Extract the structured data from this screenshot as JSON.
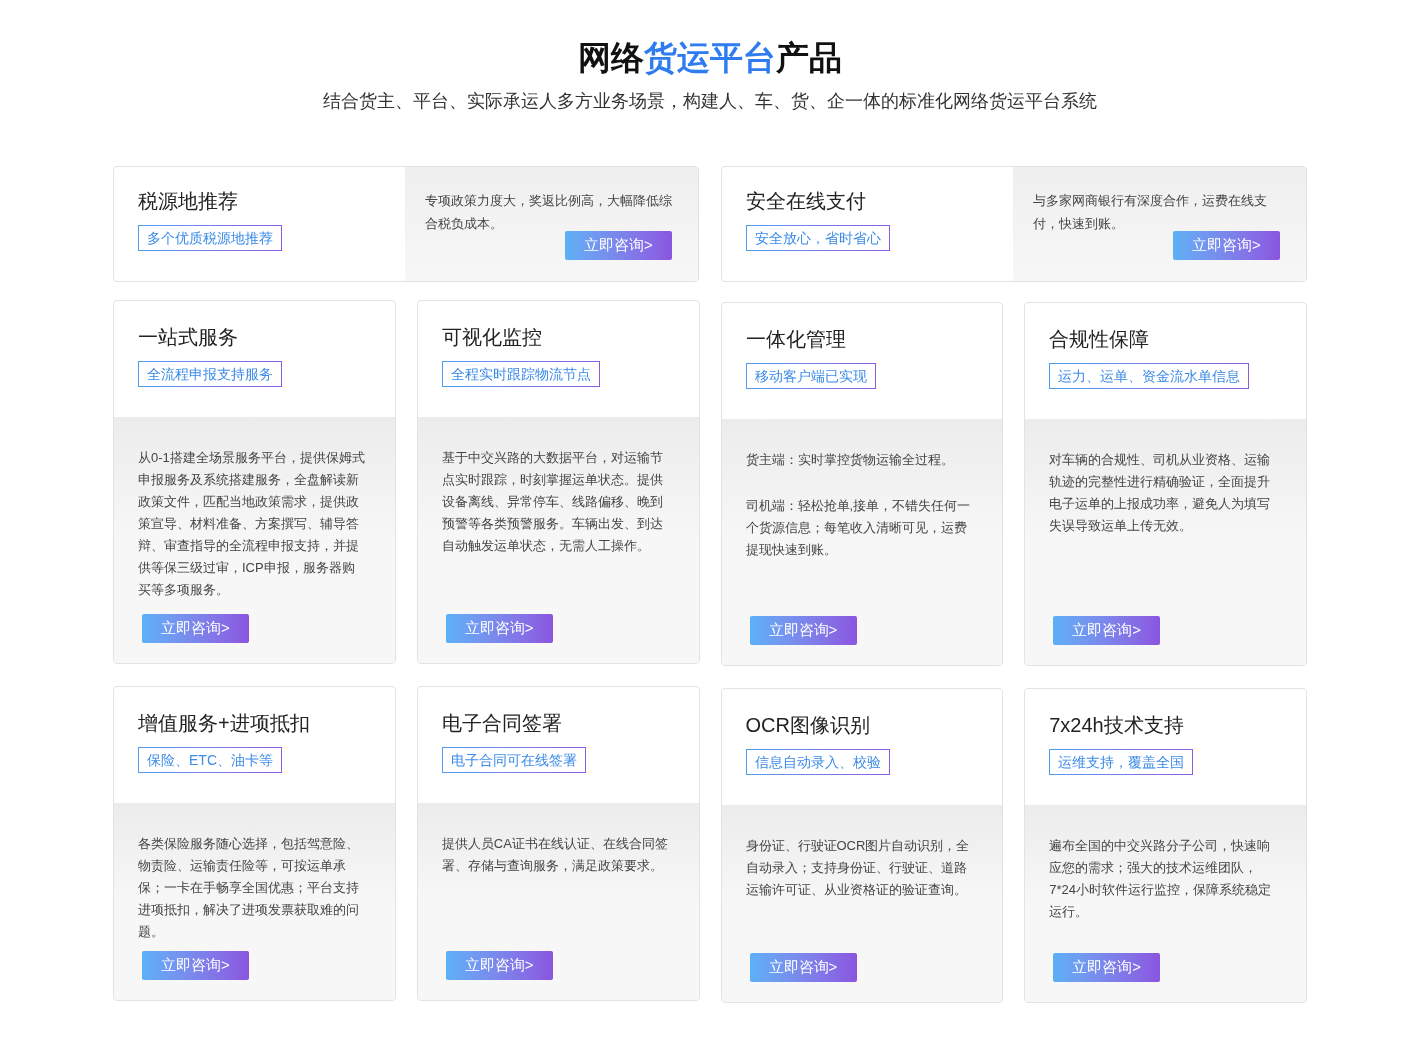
{
  "header": {
    "title": [
      {
        "text": "网络",
        "highlight": false
      },
      {
        "text": "货运平台",
        "highlight": true
      },
      {
        "text": "产品",
        "highlight": false
      }
    ],
    "subtitle": "结合货主、平台、实际承运人多方业务场景，构建人、车、货、企一体的标准化网络货运平台系统"
  },
  "wide_cards": [
    {
      "title": "税源地推荐",
      "tag": "多个优质税源地推荐",
      "description": "专项政策力度大，奖返比例高，大幅降低综合税负成本。",
      "button": "立即咨询>"
    },
    {
      "title": "安全在线支付",
      "tag": "安全放心，省时省心",
      "description": "与多家网商银行有深度合作，运费在线支付，快速到账。",
      "button": "立即咨询>"
    }
  ],
  "cards": [
    {
      "title": "一站式服务",
      "tag": "全流程申报支持服务",
      "paragraphs": [
        "从0-1搭建全场景服务平台，提供保姆式申报服务及系统搭建服务，全盘解读新政策文件，匹配当地政策需求，提供政策宣导、材料准备、方案撰写、辅导答辩、审查指导的全流程申报支持，并提供等保三级过审，ICP申报，服务器购买等多项服务。"
      ],
      "button": "立即咨询>"
    },
    {
      "title": "可视化监控",
      "tag": "全程实时跟踪物流节点",
      "paragraphs": [
        "基于中交兴路的大数据平台，对运输节点实时跟踪，时刻掌握运单状态。提供设备离线、异常停车、线路偏移、晚到预警等各类预警服务。车辆出发、到达自动触发运单状态，无需人工操作。"
      ],
      "button": "立即咨询>"
    },
    {
      "title": "一体化管理",
      "tag": "移动客户端已实现",
      "paragraphs": [
        "货主端：实时掌控货物运输全过程。",
        "司机端：轻松抢单,接单，不错失任何一个货源信息；每笔收入清晰可见，运费提现快速到账。"
      ],
      "button": "立即咨询>"
    },
    {
      "title": "合规性保障",
      "tag": "运力、运单、资金流水单信息",
      "paragraphs": [
        "对车辆的合规性、司机从业资格、运输轨迹的完整性进行精确验证，全面提升电子运单的上报成功率，避免人为填写失误导致运单上传无效。"
      ],
      "button": "立即咨询>"
    },
    {
      "title": "增值服务+进项抵扣",
      "tag": "保险、ETC、油卡等",
      "paragraphs": [
        "各类保险服务随心选择，包括驾意险、物责险、运输责任险等，可按运单承保；一卡在手畅享全国优惠；平台支持进项抵扣，解决了进项发票获取难的问题。"
      ],
      "button": "立即咨询>"
    },
    {
      "title": "电子合同签署",
      "tag": "电子合同可在线签署",
      "paragraphs": [
        "提供人员CA证书在线认证、在线合同签署、存储与查询服务，满足政策要求。"
      ],
      "button": "立即咨询>"
    },
    {
      "title": "OCR图像识别",
      "tag": "信息自动录入、校验",
      "paragraphs": [
        "身份证、行驶证OCR图片自动识别，全自动录入；支持身份证、行驶证、道路运输许可证、从业资格证的验证查询。"
      ],
      "button": "立即咨询>"
    },
    {
      "title": "7x24h技术支持",
      "tag": "运维支持，覆盖全国",
      "paragraphs": [
        "遍布全国的中交兴路分子公司，快速响应您的需求；强大的技术运维团队，7*24小时软件运行监控，保障系统稳定运行。"
      ],
      "button": "立即咨询>"
    }
  ]
}
